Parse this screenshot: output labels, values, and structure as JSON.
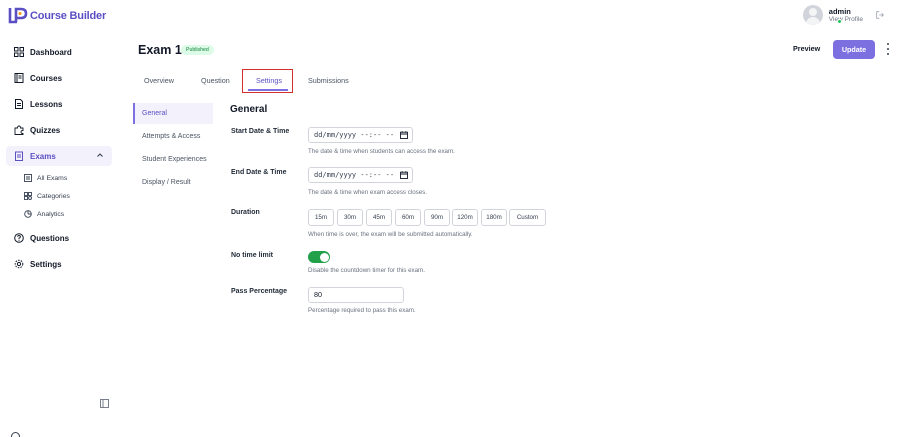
{
  "app": {
    "logo_mark": "LP",
    "brand_name": "Course Builder",
    "brand_color": "#5b4fc4",
    "accent_color": "#7c6fe0"
  },
  "user": {
    "name": "admin",
    "subtitle": "View Profile",
    "status_color": "#22c55e",
    "logout_icon": "logout-icon"
  },
  "sidebar": {
    "items": [
      {
        "label": "Dashboard",
        "icon": "grid-icon"
      },
      {
        "label": "Courses",
        "icon": "book-icon"
      },
      {
        "label": "Lessons",
        "icon": "document-icon"
      },
      {
        "label": "Quizzes",
        "icon": "puzzle-icon"
      },
      {
        "label": "Exams",
        "icon": "clipboard-icon",
        "active": true,
        "expanded": true
      },
      {
        "label": "Questions",
        "icon": "question-circle-icon"
      },
      {
        "label": "Settings",
        "icon": "gear-icon"
      }
    ],
    "exam_subitems": [
      {
        "label": "All Exams",
        "icon": "list-icon"
      },
      {
        "label": "Categories",
        "icon": "categories-icon"
      },
      {
        "label": "Analytics",
        "icon": "pie-chart-icon"
      }
    ]
  },
  "header": {
    "title": "Exam 1",
    "status_badge": "Published",
    "preview_label": "Preview",
    "update_label": "Update"
  },
  "tabs": [
    {
      "label": "Overview"
    },
    {
      "label": "Question"
    },
    {
      "label": "Settings",
      "active": true
    },
    {
      "label": "Submissions"
    }
  ],
  "settings_nav": [
    {
      "label": "General",
      "active": true
    },
    {
      "label": "Attempts & Access"
    },
    {
      "label": "Student Experiences"
    },
    {
      "label": "Display / Result"
    }
  ],
  "form": {
    "section_title": "General",
    "start_date": {
      "label": "Start Date & Time",
      "placeholder": "dd/mm/yyyy --:-- --",
      "help": "The date & time when students can access the exam."
    },
    "end_date": {
      "label": "End Date & Time",
      "placeholder": "dd/mm/yyyy --:-- --",
      "help": "The date & time when exam access closes."
    },
    "duration": {
      "label": "Duration",
      "options": [
        "15m",
        "30m",
        "45m",
        "60m",
        "90m",
        "120m",
        "180m",
        "Custom"
      ],
      "help": "When time is over, the exam will be submitted automatically."
    },
    "no_time_limit": {
      "label": "No time limit",
      "enabled": true,
      "on_color": "#22a04a",
      "help": "Disable the countdown timer for this exam."
    },
    "pass_percentage": {
      "label": "Pass Percentage",
      "value": "80",
      "help": "Percentage required to pass this exam."
    }
  }
}
